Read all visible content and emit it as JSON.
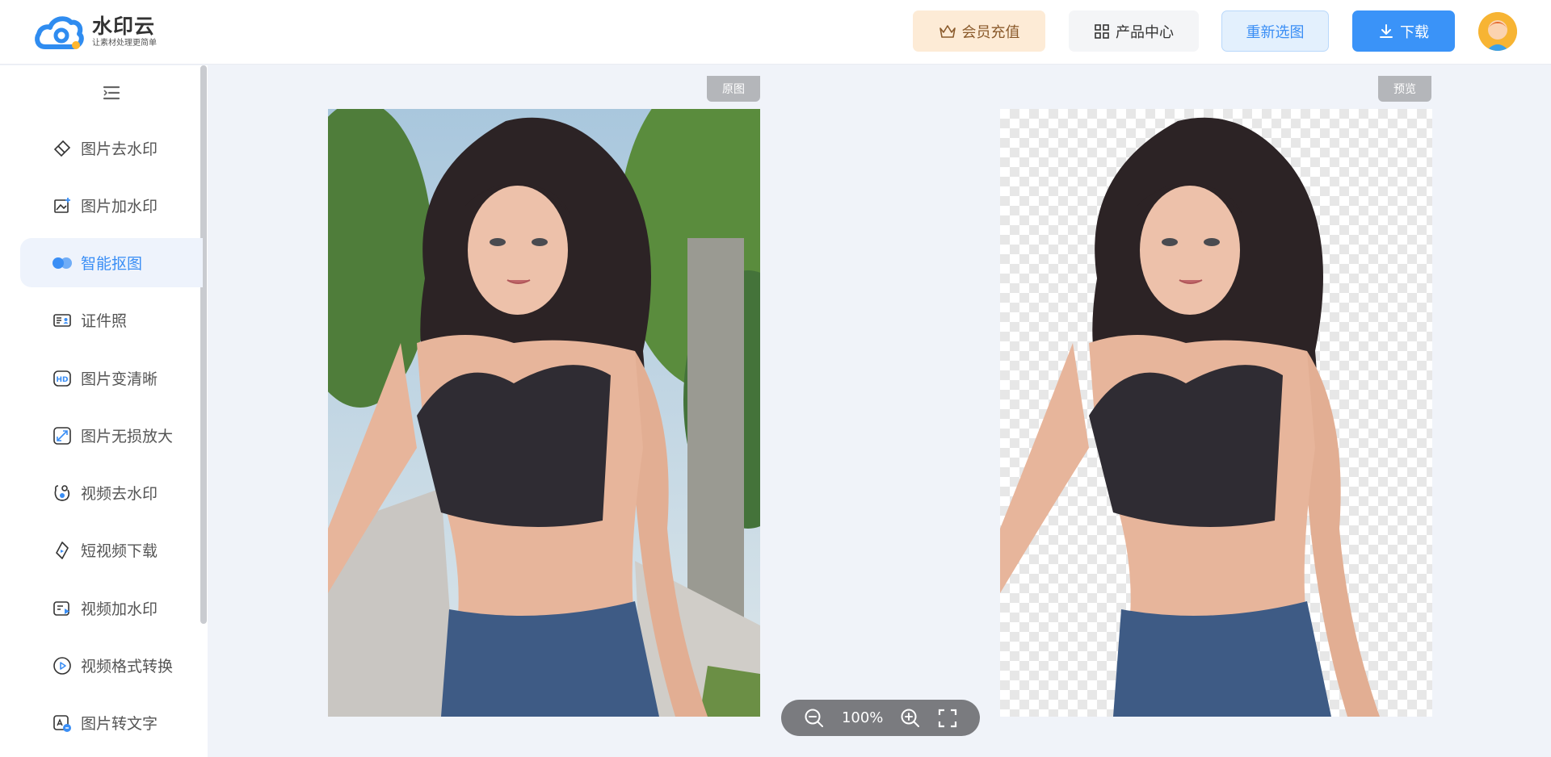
{
  "brand": {
    "name": "水印云",
    "slogan": "让素材处理更简单"
  },
  "header": {
    "vip_label": "会员充值",
    "products_label": "产品中心",
    "reselect_label": "重新选图",
    "download_label": "下载"
  },
  "sidebar": {
    "items": [
      {
        "label": "图片去水印",
        "icon": "eraser-icon"
      },
      {
        "label": "图片加水印",
        "icon": "image-add-icon"
      },
      {
        "label": "智能抠图",
        "icon": "cutout-icon",
        "active": true
      },
      {
        "label": "证件照",
        "icon": "id-card-icon"
      },
      {
        "label": "图片变清晰",
        "icon": "hd-icon"
      },
      {
        "label": "图片无损放大",
        "icon": "enlarge-icon"
      },
      {
        "label": "视频去水印",
        "icon": "video-eraser-icon"
      },
      {
        "label": "短视频下载",
        "icon": "short-video-download-icon"
      },
      {
        "label": "视频加水印",
        "icon": "video-add-icon"
      },
      {
        "label": "视频格式转换",
        "icon": "play-circle-icon"
      },
      {
        "label": "图片转文字",
        "icon": "image-to-text-icon"
      }
    ]
  },
  "preview": {
    "original_tag": "原图",
    "result_tag": "预览"
  },
  "zoom": {
    "value": "100%"
  },
  "colors": {
    "accent": "#3a8ef5",
    "vip": "#fdebd6",
    "download": "#3a93f8"
  }
}
